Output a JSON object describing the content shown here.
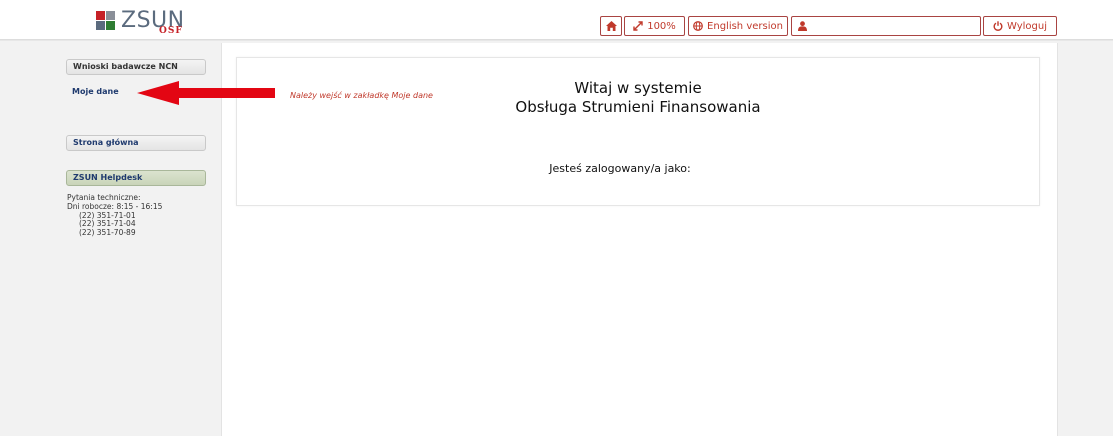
{
  "app": {
    "logo_text": "ZSUN",
    "logo_sub": "OSF",
    "colors": {
      "accent": "#c0392b",
      "link": "#1f3a6e"
    }
  },
  "toolbar": {
    "home_icon": "home-icon",
    "zoom_label": "100%",
    "zoom_icon": "resize-icon",
    "language_label": "English version",
    "language_icon": "globe-icon",
    "user_icon": "user-icon",
    "user_name": "",
    "logout_label": "Wyloguj",
    "logout_icon": "power-icon"
  },
  "sidebar": {
    "items": [
      {
        "label": "Wnioski badawcze NCN"
      },
      {
        "label": "Moje dane"
      },
      {
        "label": "Strona główna"
      }
    ],
    "helpdesk": {
      "title": "ZSUN Helpdesk",
      "lines": [
        "Pytania techniczne:",
        "Dni robocze: 8:15 - 16:15"
      ],
      "phones": [
        "(22) 351-71-01",
        "(22) 351-71-04",
        "(22) 351-70-89"
      ]
    }
  },
  "main": {
    "welcome_line1": "Witaj w systemie",
    "welcome_line2": "Obsługa Strumieni Finansowania",
    "logged_as": "Jesteś zalogowany/a jako:",
    "hint": "Należy wejść w zakładkę Moje dane"
  }
}
